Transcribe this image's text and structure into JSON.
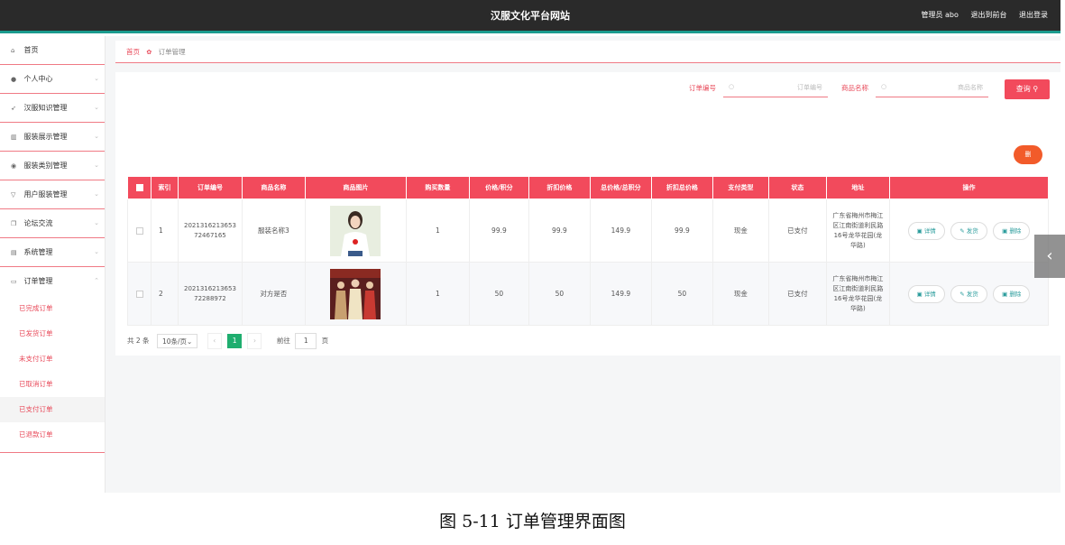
{
  "header": {
    "title": "汉服文化平台网站",
    "admin": "管理员 abo",
    "back": "退出到前台",
    "logout": "退出登录"
  },
  "sidebar": {
    "items": [
      {
        "label": "首页",
        "icon": "home-icon"
      },
      {
        "label": "个人中心",
        "icon": "user-icon"
      },
      {
        "label": "汉服知识管理",
        "icon": "send-icon"
      },
      {
        "label": "服装展示管理",
        "icon": "bar-chart-icon"
      },
      {
        "label": "服装类别管理",
        "icon": "location-icon"
      },
      {
        "label": "用户服装管理",
        "icon": "filter-icon"
      },
      {
        "label": "论坛交流",
        "icon": "copy-icon"
      },
      {
        "label": "系统管理",
        "icon": "menu-icon"
      },
      {
        "label": "订单管理",
        "icon": "order-icon"
      }
    ],
    "sub_items": [
      "已完成订单",
      "已发货订单",
      "未支付订单",
      "已取消订单",
      "已支付订单",
      "已退款订单"
    ]
  },
  "breadcrumb": {
    "home": "首页",
    "current": "订单管理"
  },
  "search": {
    "order_label": "订单编号",
    "order_placeholder": "订单编号",
    "goods_label": "商品名称",
    "goods_placeholder": "商品名称",
    "query_label": "查询"
  },
  "delete_label": "删",
  "table": {
    "headers": [
      "索引",
      "订单编号",
      "商品名称",
      "商品图片",
      "购买数量",
      "价格/积分",
      "折扣价格",
      "总价格/总积分",
      "折扣总价格",
      "支付类型",
      "状态",
      "地址",
      "操作"
    ],
    "rows": [
      {
        "index": "1",
        "order_no": "2021316213653 72467165",
        "goods": "服装名称3",
        "qty": "1",
        "price": "99.9",
        "disc_price": "99.9",
        "total": "149.9",
        "disc_total": "99.9",
        "pay": "现金",
        "status": "已支付",
        "address": "广东省梅州市梅江区江南街道利民路16号龙华花园(龙华路)"
      },
      {
        "index": "2",
        "order_no": "2021316213653 72288972",
        "goods": "对方是否",
        "qty": "1",
        "price": "50",
        "disc_price": "50",
        "total": "149.9",
        "disc_total": "50",
        "pay": "现金",
        "status": "已支付",
        "address": "广东省梅州市梅江区江南街道利民路16号龙华花园(龙华路)"
      }
    ],
    "actions": {
      "detail": "详情",
      "ship": "发货",
      "delete": "删除"
    }
  },
  "pager": {
    "total": "共 2 条",
    "size": "10条/页",
    "page": "1",
    "goto": "前往",
    "goto_value": "1",
    "unit": "页"
  },
  "caption": "图 5-11 订单管理界面图"
}
